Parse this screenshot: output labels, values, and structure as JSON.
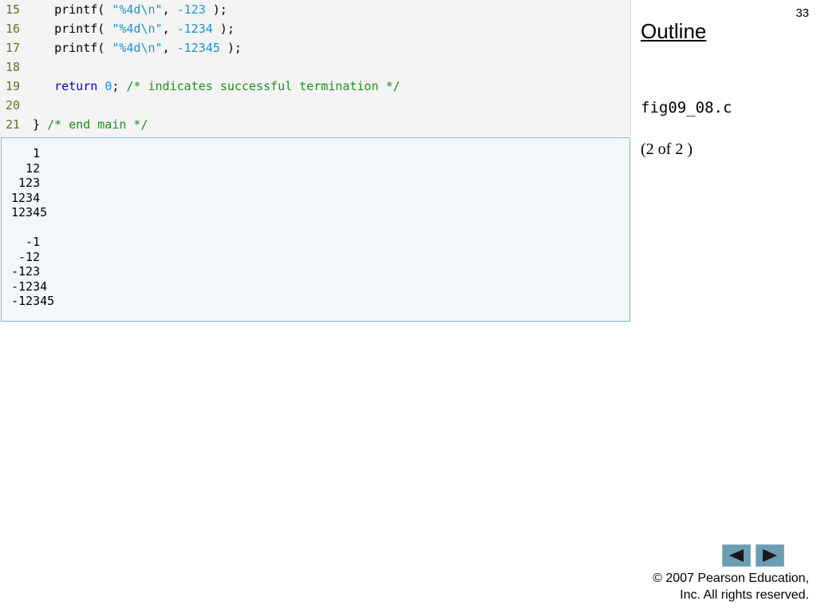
{
  "slide": {
    "number": "33"
  },
  "sidebar": {
    "outline_label": "Outline",
    "file_name": "fig09_08.c",
    "page_indicator": "(2 of 2 )"
  },
  "code": {
    "lines": [
      {
        "num": "15",
        "indent": "   ",
        "pre": "printf( ",
        "str": "\"%4d\\n\"",
        "mid": ", ",
        "arg": "-123",
        "post": " );"
      },
      {
        "num": "16",
        "indent": "   ",
        "pre": "printf( ",
        "str": "\"%4d\\n\"",
        "mid": ", ",
        "arg": "-1234",
        "post": " );"
      },
      {
        "num": "17",
        "indent": "   ",
        "pre": "printf( ",
        "str": "\"%4d\\n\"",
        "mid": ", ",
        "arg": "-12345",
        "post": " );"
      },
      {
        "num": "18"
      },
      {
        "num": "19",
        "indent": "   ",
        "kw": "return",
        "sp": " ",
        "val": "0",
        "semi": "; ",
        "comment": "/* indicates successful termination */"
      },
      {
        "num": "20"
      },
      {
        "num": "21",
        "brace": "} ",
        "comment": "/* end main */"
      }
    ]
  },
  "output": {
    "lines": [
      "   1",
      "  12",
      " 123",
      "1234",
      "12345",
      "",
      "  -1",
      " -12",
      "-123",
      "-1234",
      "-12345"
    ]
  },
  "nav": {
    "prev_icon": "left-triangle-icon",
    "next_icon": "right-triangle-icon",
    "color": "#6b9db3"
  },
  "footer": {
    "copyright_line1": "© 2007 Pearson Education,",
    "copyright_line2": "Inc.  All rights reserved."
  }
}
